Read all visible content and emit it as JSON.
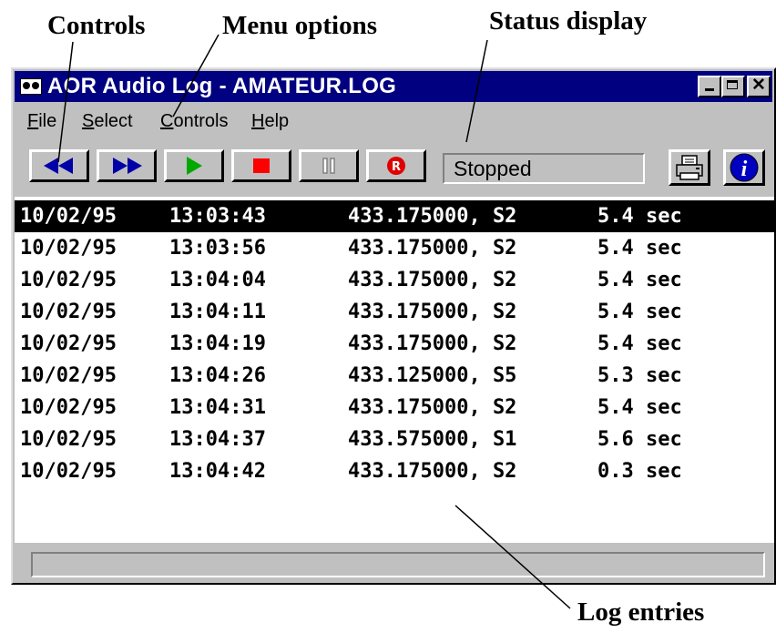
{
  "annotations": {
    "controls": "Controls",
    "menu_options": "Menu options",
    "status_display": "Status display",
    "log_entries": "Log entries"
  },
  "window": {
    "title": "AOR Audio Log - AMATEUR.LOG",
    "icon": "app-speaker-icon",
    "title_buttons": [
      "minimize-icon",
      "maximize-icon",
      "close-icon"
    ],
    "close_glyph": "✕"
  },
  "menu": {
    "items": [
      {
        "label_ul": "F",
        "label_rest": "ile"
      },
      {
        "label_ul": "S",
        "label_rest": "elect"
      },
      {
        "label_ul": "C",
        "label_rest": "ontrols"
      },
      {
        "label_ul": "H",
        "label_rest": "elp"
      }
    ]
  },
  "toolbar": {
    "buttons": [
      "rewind-icon",
      "fast-forward-icon",
      "play-icon",
      "stop-icon",
      "pause-icon",
      "record-icon"
    ],
    "status": "Stopped",
    "print_icon": "printer-icon",
    "info_icon": "info-icon",
    "info_glyph": "i",
    "record_glyph": "R"
  },
  "colors": {
    "titlebar": "#000080",
    "rewind": "#0000a8",
    "play": "#00a800",
    "stop": "#ff0000",
    "record": "#e00000"
  },
  "log": {
    "selected_index": 0,
    "entries": [
      {
        "date": "10/02/95",
        "time": "13:03:43",
        "freq": "433.175000, S2",
        "duration": "5.4 sec"
      },
      {
        "date": "10/02/95",
        "time": "13:03:56",
        "freq": "433.175000, S2",
        "duration": "5.4 sec"
      },
      {
        "date": "10/02/95",
        "time": "13:04:04",
        "freq": "433.175000, S2",
        "duration": "5.4 sec"
      },
      {
        "date": "10/02/95",
        "time": "13:04:11",
        "freq": "433.175000, S2",
        "duration": "5.4 sec"
      },
      {
        "date": "10/02/95",
        "time": "13:04:19",
        "freq": "433.175000, S2",
        "duration": "5.4 sec"
      },
      {
        "date": "10/02/95",
        "time": "13:04:26",
        "freq": "433.125000, S5",
        "duration": "5.3 sec"
      },
      {
        "date": "10/02/95",
        "time": "13:04:31",
        "freq": "433.175000, S2",
        "duration": "5.4 sec"
      },
      {
        "date": "10/02/95",
        "time": "13:04:37",
        "freq": "433.575000, S1",
        "duration": "5.6 sec"
      },
      {
        "date": "10/02/95",
        "time": "13:04:42",
        "freq": "433.175000, S2",
        "duration": "0.3 sec"
      }
    ]
  }
}
